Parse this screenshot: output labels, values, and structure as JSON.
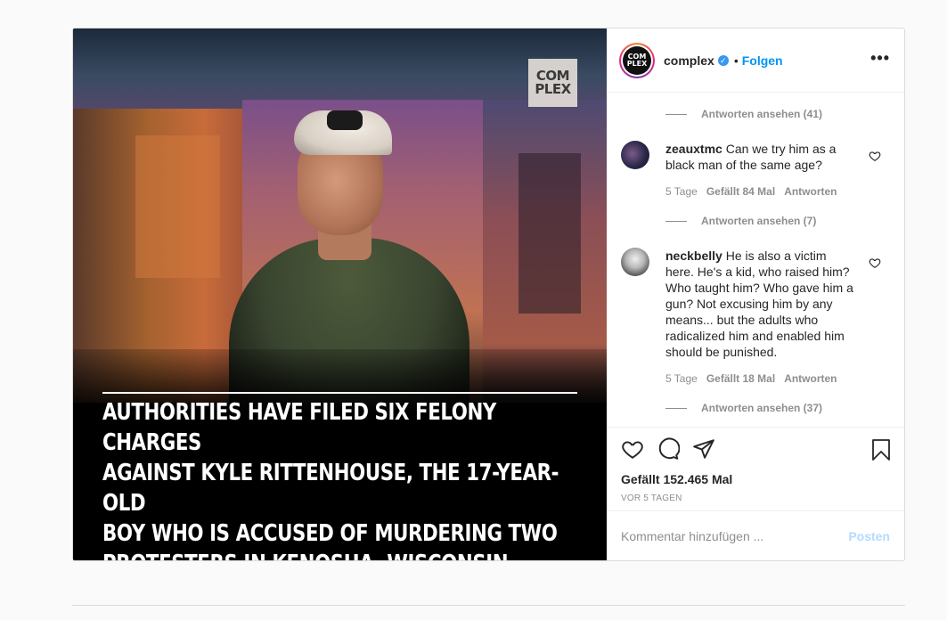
{
  "media": {
    "logo_line1": "COM",
    "logo_line2": "PLEX",
    "caption_lines": [
      "AUTHORITIES HAVE FILED SIX FELONY CHARGES",
      "AGAINST KYLE RITTENHOUSE, THE 17-YEAR-OLD",
      "BOY WHO IS ACCUSED OF MURDERING TWO",
      "PROTESTERS IN KENOSHA, WISCONSIN."
    ]
  },
  "header": {
    "username": "complex",
    "verified_icon": "check",
    "separator": "•",
    "follow_label": "Folgen",
    "more_icon": "•••",
    "avatar_line1": "COM",
    "avatar_line2": "PLEX"
  },
  "comments": {
    "replies_top": "Antworten ansehen (41)",
    "items": [
      {
        "user": "zeauxtmc",
        "text": "Can we try him as a black man of the same age?",
        "age": "5 Tage",
        "likes": "Gefällt 84 Mal",
        "reply": "Antworten",
        "replies": "Antworten ansehen (7)"
      },
      {
        "user": "neckbelly",
        "text": "He is also a victim here. He's a kid, who raised him? Who taught him? Who gave him a gun? Not excusing him by any means... but the adults who radicalized him and enabled him should be punished.",
        "age": "5 Tage",
        "likes": "Gefällt 18 Mal",
        "reply": "Antworten",
        "replies": "Antworten ansehen (37)"
      }
    ]
  },
  "actions": {
    "likes": "Gefällt 152.465 Mal",
    "ago": "VOR 5 TAGEN"
  },
  "comment_box": {
    "placeholder": "Kommentar hinzufügen ...",
    "post_label": "Posten"
  },
  "colors": {
    "accent": "#0095f6",
    "muted": "#8e8e8e",
    "post_disabled": "#b3dbff"
  }
}
